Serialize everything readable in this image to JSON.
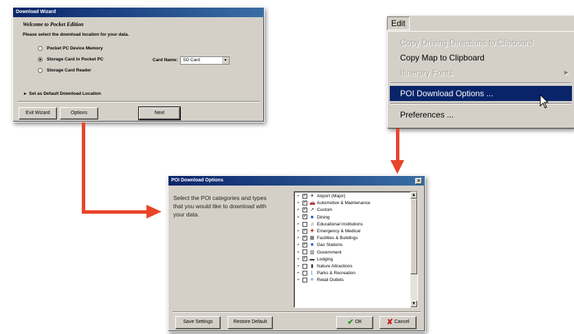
{
  "wizard": {
    "title": "Download Wizard",
    "heading": "Welcome to Pocket Edition",
    "prompt": "Please select the download location for your data.",
    "options": [
      {
        "label": "Pocket PC Device Memory",
        "selected": false
      },
      {
        "label": "Storage Card in Pocket PC",
        "selected": true
      },
      {
        "label": "Storage Card Reader",
        "selected": false
      }
    ],
    "card_name_label": "Card Name:",
    "card_name_value": "SD Card",
    "default_location": "Set as Default Download Location",
    "buttons": {
      "exit": "Exit Wizard",
      "options": "Options",
      "next": "Next"
    }
  },
  "edit_menu": {
    "title": "Edit",
    "items": [
      {
        "label": "Copy Driving Directions to Clipboard",
        "enabled": false
      },
      {
        "label": "Copy Map to Clipboard",
        "enabled": true
      },
      {
        "label": "Itinerary Fonts",
        "enabled": false,
        "submenu": true
      },
      {
        "label": "POI Download Options ...",
        "enabled": true,
        "highlighted": true
      },
      {
        "label": "Preferences ...",
        "enabled": true
      }
    ]
  },
  "poi_dialog": {
    "title": "POI Download Options",
    "instructions": "Select the POI categories and types that you would like to download with your data.",
    "categories": [
      {
        "label": "Airport (Major)",
        "checked": true,
        "icon": "✈",
        "color": "#333"
      },
      {
        "label": "Automotive & Maintenance",
        "checked": true,
        "icon": "🚗",
        "color": "#1a4f9c"
      },
      {
        "label": "Custom",
        "checked": true,
        "icon": "↗",
        "color": "#333"
      },
      {
        "label": "Dining",
        "checked": true,
        "icon": "■",
        "color": "#2060c0"
      },
      {
        "label": "Educational Institutions",
        "checked": false,
        "icon": "♫",
        "color": "#333"
      },
      {
        "label": "Emergency & Medical",
        "checked": true,
        "icon": "✚",
        "color": "#d02020"
      },
      {
        "label": "Facilities & Buildings",
        "checked": true,
        "icon": "▦",
        "color": "#333"
      },
      {
        "label": "Gas Stations",
        "checked": true,
        "icon": "■",
        "color": "#2060c0"
      },
      {
        "label": "Government",
        "checked": false,
        "icon": "▥",
        "color": "#333"
      },
      {
        "label": "Lodging",
        "checked": true,
        "icon": "▬",
        "color": "#333"
      },
      {
        "label": "Nature Attractions",
        "checked": false,
        "icon": "▮",
        "color": "#333"
      },
      {
        "label": "Parks & Recreation",
        "checked": false,
        "icon": "⌊",
        "color": "#2060c0"
      },
      {
        "label": "Retail Outlets",
        "checked": false,
        "icon": "¤",
        "color": "#2060c0"
      }
    ],
    "buttons": {
      "save": "Save Settings",
      "restore": "Restore Default",
      "ok": "OK",
      "cancel": "Cancel"
    }
  },
  "accent_color": "#e8452a"
}
